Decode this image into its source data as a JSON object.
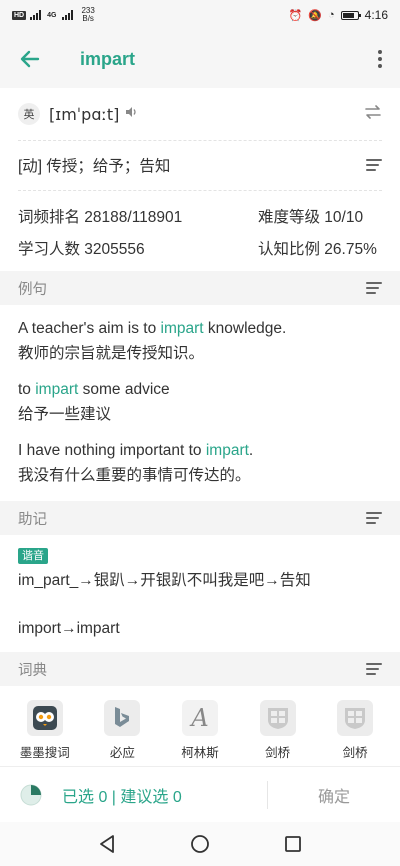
{
  "status_bar": {
    "sim_badge": "HD",
    "net_badge": "4G",
    "speed_value": "233",
    "speed_unit": "B/s",
    "time": "4:16",
    "battery_level": 0.75
  },
  "app_bar": {
    "title": "impart"
  },
  "pronunciation": {
    "lang": "英",
    "phonetic": "[ɪmˈpɑːt]"
  },
  "definition": {
    "text": "[动] 传授；给予；告知"
  },
  "stats": {
    "freq_rank": "词频排名 28188/118901",
    "difficulty": "难度等级 10/10",
    "learners": "学习人数 3205556",
    "recognition": "认知比例 26.75%"
  },
  "sections": {
    "examples": "例句",
    "mnemonic": "助记",
    "dictionary": "词典"
  },
  "examples": [
    {
      "en_before": "A teacher's aim is to ",
      "en_word": "impart",
      "en_after": " knowledge.",
      "zh": "教师的宗旨就是传授知识。"
    },
    {
      "en_before": "to ",
      "en_word": "impart",
      "en_after": " some advice",
      "zh": "给予一些建议"
    },
    {
      "en_before": "I have nothing important to ",
      "en_word": "impart",
      "en_after": ".",
      "zh": "我没有什么重要的事情可传达的。"
    }
  ],
  "mnemonic": {
    "tag": "谐音",
    "line1": "im_part_→银趴→开银趴不叫我是吧→告知",
    "line2": "import→impart"
  },
  "dictionaries": [
    {
      "label": "墨墨搜词",
      "icon": "owl-icon"
    },
    {
      "label": "必应",
      "icon": "bing-icon"
    },
    {
      "label": "柯林斯",
      "icon": "collins-icon"
    },
    {
      "label": "剑桥",
      "icon": "cambridge-icon"
    },
    {
      "label": "剑桥",
      "icon": "cambridge-icon"
    }
  ],
  "bottom_bar": {
    "selected": "已选 0 | 建议选 0",
    "confirm": "确定",
    "progress": 0.25
  },
  "colors": {
    "accent": "#2aa58a"
  }
}
